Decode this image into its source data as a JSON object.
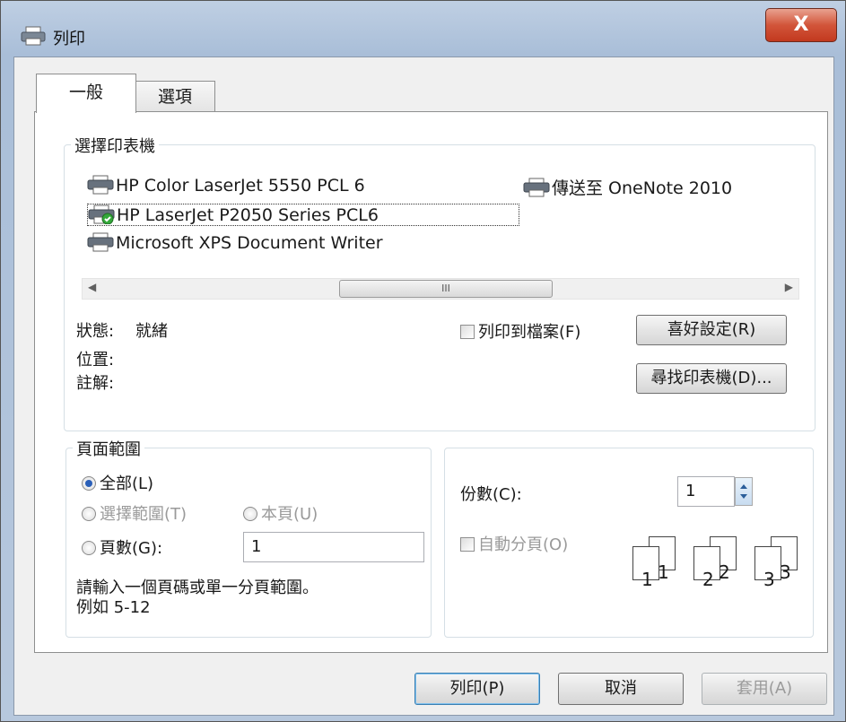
{
  "window": {
    "title": "列印",
    "close_label": "X"
  },
  "tabs": [
    {
      "label": "一般"
    },
    {
      "label": "選項"
    }
  ],
  "select_printer": {
    "group_label": "選擇印表機",
    "printers": [
      {
        "name": "HP Color LaserJet 5550 PCL 6"
      },
      {
        "name": "傳送至 OneNote 2010"
      },
      {
        "name": "HP LaserJet P2050 Series PCL6",
        "selected": true,
        "default": true
      },
      {
        "name": "Microsoft XPS Document Writer"
      }
    ],
    "scroll_thumb_label": "III",
    "status_label": "狀態:",
    "status_value": "就緒",
    "location_label": "位置:",
    "comment_label": "註解:",
    "print_to_file_label": "列印到檔案(F)",
    "preferences_button": "喜好設定(R)",
    "find_printer_button": "尋找印表機(D)..."
  },
  "page_range": {
    "group_label": "頁面範圍",
    "all_label": "全部(L)",
    "selection_label": "選擇範圍(T)",
    "current_page_label": "本頁(U)",
    "pages_label": "頁數(G):",
    "pages_value": "1",
    "hint_line1": "請輸入一個頁碼或單一分頁範圍。",
    "hint_line2": "例如 5-12"
  },
  "copies": {
    "copies_label": "份數(C):",
    "copies_value": "1",
    "collate_label": "自動分頁(O)",
    "collate_numbers": [
      "1",
      "1",
      "2",
      "2",
      "3",
      "3"
    ]
  },
  "footer": {
    "print_button": "列印(P)",
    "cancel_button": "取消",
    "apply_button": "套用(A)"
  }
}
